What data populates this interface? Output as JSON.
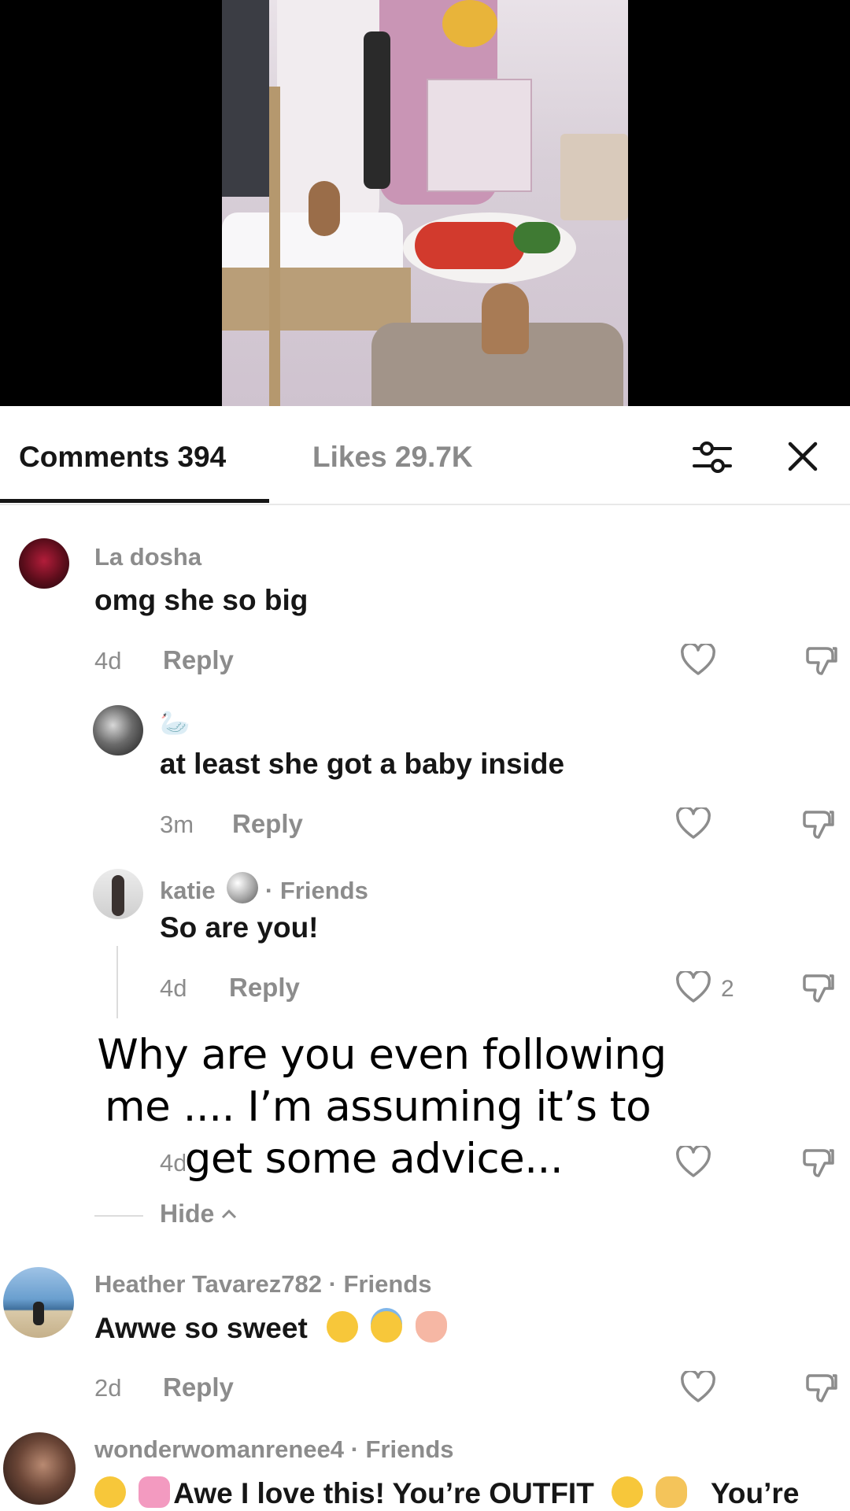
{
  "tabs": {
    "comments": "Comments 394",
    "likes": "Likes 29.7K"
  },
  "comments": [
    {
      "name": "La dosha",
      "text": "omg she so big",
      "time": "4d",
      "reply": "Reply"
    },
    {
      "name": "🦢",
      "text": "at least she got a baby inside",
      "time": "3m",
      "reply": "Reply"
    },
    {
      "name": "katie",
      "badge": "· Friends",
      "text": "So are you!",
      "time": "4d",
      "reply": "Reply",
      "likes": "2"
    },
    {
      "time": "4d"
    },
    {
      "name": "Heather Tavarez782",
      "badge": "· Friends",
      "text": "Awwe so sweet",
      "time": "2d",
      "reply": "Reply"
    },
    {
      "name": "wonderwomanrenee4",
      "badge": "· Friends",
      "text": "Awe I love this! You’re OUTFIT",
      "tail": "You’re"
    }
  ],
  "hide_label": "Hide",
  "overlay_caption": "Why are you even following me .... I’m assuming it’s to get some advice..."
}
